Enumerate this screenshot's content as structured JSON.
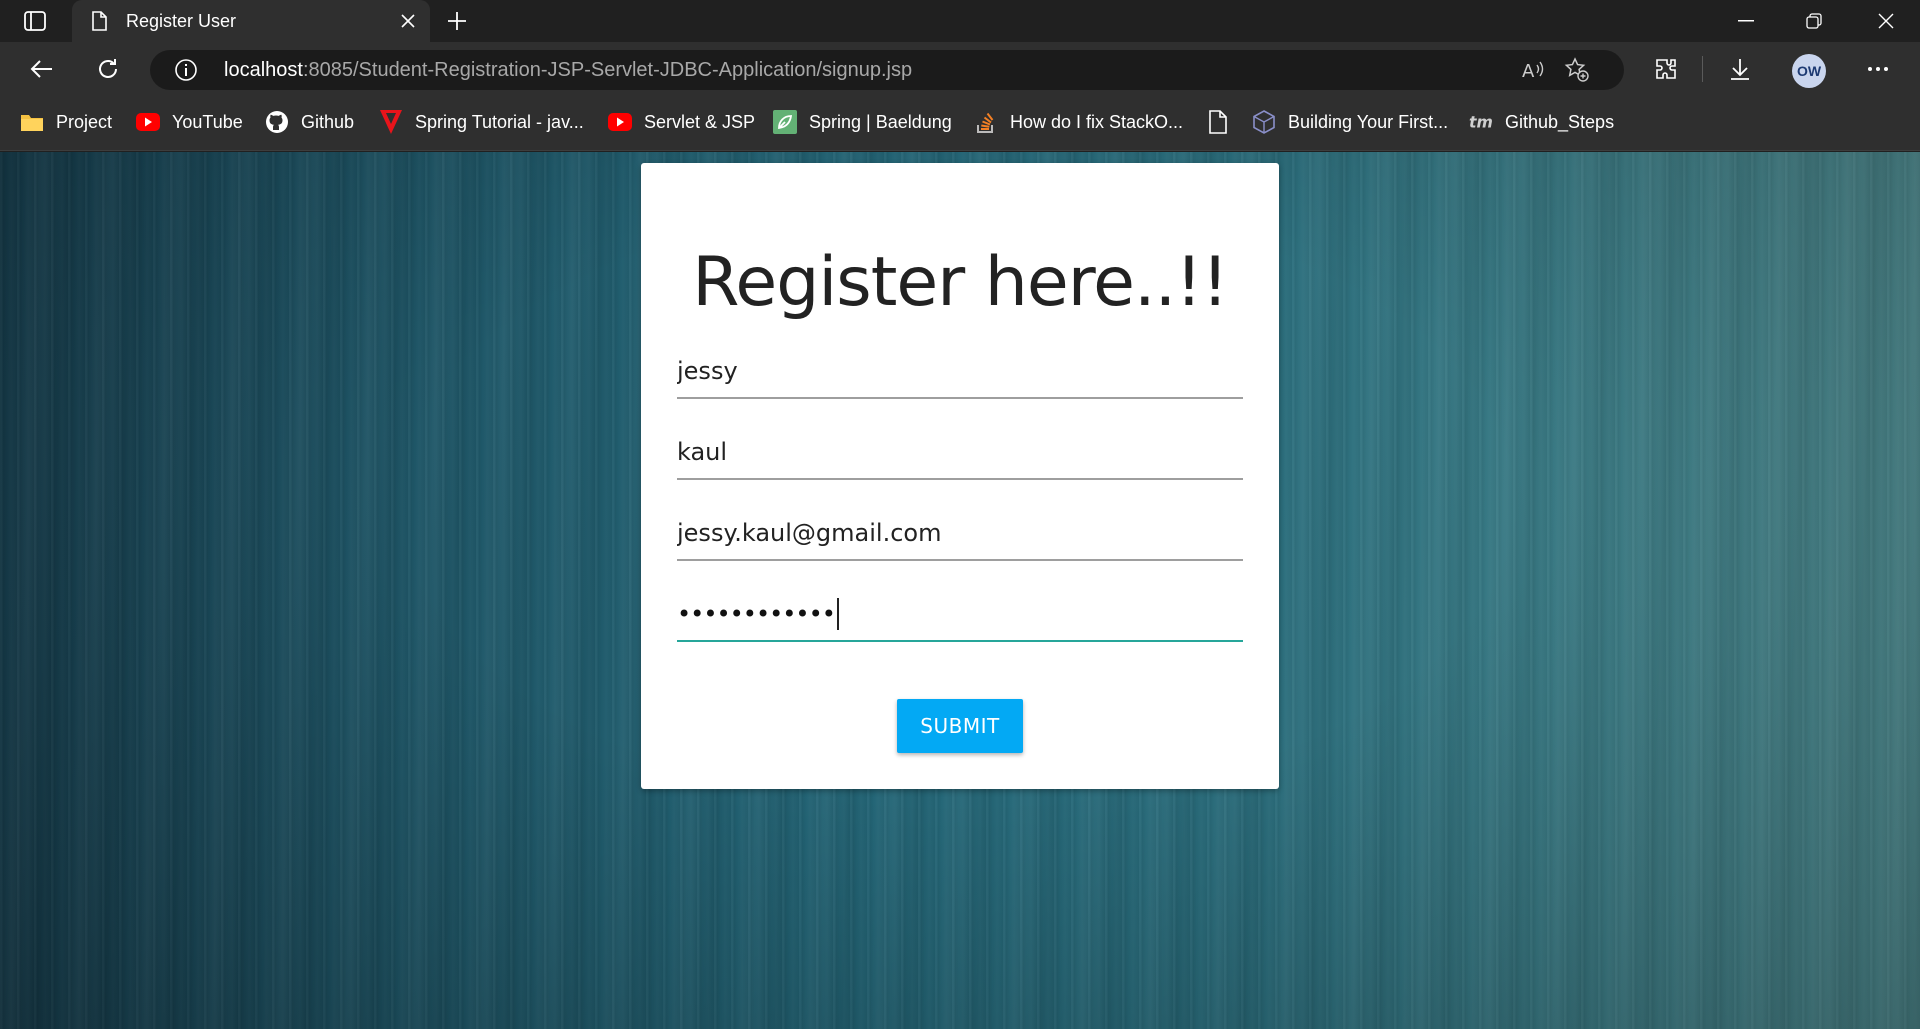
{
  "browser": {
    "tab_title": "Register User",
    "address": {
      "host": "localhost",
      "path": ":8085/Student-Registration-JSP-Servlet-JDBC-Application/signup.jsp"
    },
    "profile_initials": "OW",
    "bookmarks": [
      {
        "label": "Project",
        "icon": "folder-icon"
      },
      {
        "label": "YouTube",
        "icon": "youtube-icon"
      },
      {
        "label": "Github",
        "icon": "github-icon"
      },
      {
        "label": "Spring Tutorial - jav...",
        "icon": "spring-tutorial-icon"
      },
      {
        "label": "Servlet & JSP",
        "icon": "youtube-icon"
      },
      {
        "label": "Spring | Baeldung",
        "icon": "baeldung-icon"
      },
      {
        "label": "How do I fix StackO...",
        "icon": "stackoverflow-icon"
      },
      {
        "label": "",
        "icon": "document-icon"
      },
      {
        "label": "Building Your First...",
        "icon": "cube-icon"
      },
      {
        "label": "Github_Steps",
        "icon": "tm-icon"
      }
    ]
  },
  "form": {
    "title": "Register here..!!",
    "first_name": "jessy",
    "last_name": "kaul",
    "email": "jessy.kaul@gmail.com",
    "password_mask": "••••••••••••",
    "submit_label": "SUBMIT"
  },
  "colors": {
    "accent": "#26a69a",
    "submit": "#03a9f4",
    "chrome": "#202020"
  }
}
